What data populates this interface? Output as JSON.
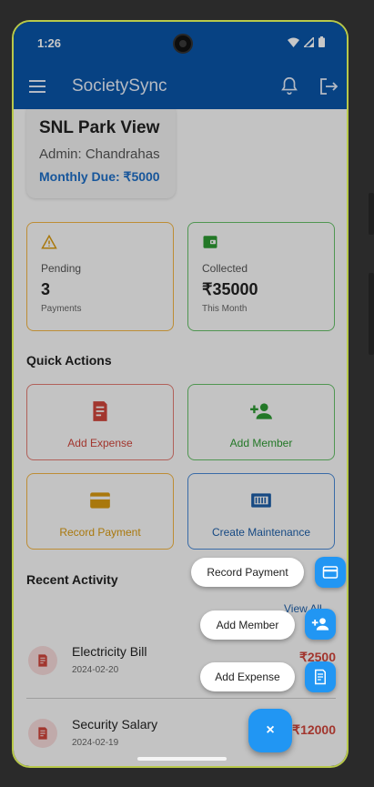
{
  "status_bar": {
    "time": "1:26"
  },
  "app_bar": {
    "title": "SocietySync"
  },
  "society": {
    "name": "SNL Park View",
    "admin": "Admin: Chandrahas",
    "monthly_due": "Monthly Due: ₹5000"
  },
  "stats": {
    "pending": {
      "label": "Pending",
      "value": "3",
      "sub": "Payments"
    },
    "collected": {
      "label": "Collected",
      "value": "₹35000",
      "sub": "This Month"
    }
  },
  "quick_actions": {
    "title": "Quick Actions",
    "add_expense": "Add Expense",
    "add_member": "Add Member",
    "record_payment": "Record Payment",
    "create_maintenance": "Create Maintenance"
  },
  "recent_activity": {
    "title": "Recent Activity",
    "view_all": "View All",
    "items": [
      {
        "title": "Electricity Bill",
        "date": "2024-02-20",
        "amount": "₹2500"
      },
      {
        "title": "Security Salary",
        "date": "2024-02-19",
        "amount": "₹12000"
      }
    ]
  },
  "fab_menu": {
    "record_payment": "Record Payment",
    "add_member": "Add Member",
    "add_expense": "Add Expense",
    "close": "×"
  },
  "colors": {
    "primary": "#0a55a8",
    "fab": "#2196f3",
    "expense": "#d0463c",
    "member": "#2e9a33",
    "payment": "#d99a11"
  }
}
